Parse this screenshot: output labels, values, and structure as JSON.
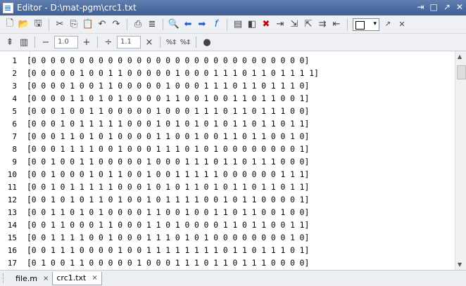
{
  "window": {
    "title": "Editor - D:\\mat-pgm\\crc1.txt",
    "controls": [
      "⇥",
      "□",
      "↗",
      "✕"
    ]
  },
  "toolbar2": {
    "decrement_value": "1.0",
    "increment_value": "1.1"
  },
  "editor": {
    "lines": [
      {
        "n": "1",
        "text": "[0 0 0 0 0 0 0 0 0 0 0 0 0 0 0 0 0 0 0 0 0 0 0 0 0 0 0 0 0]"
      },
      {
        "n": "2",
        "text": "[0 0 0 0 0 1 0 0 1 1 0 0 0 0 0 1 0 0 0 1 1 1 0 1 1 0 1 1 1 1]"
      },
      {
        "n": "3",
        "text": "[0 0 0 0 1 0 0 1 1 0 0 0 0 0 1 0 0 0 1 1 1 0 1 1 0 1 1 1 0]"
      },
      {
        "n": "4",
        "text": "[0 0 0 0 1 1 0 1 0 1 0 0 0 0 1 1 0 0 1 0 0 1 1 0 1 1 0 0 1]"
      },
      {
        "n": "5",
        "text": "[0 0 0 1 0 0 1 1 0 0 0 0 0 1 0 0 0 1 1 1 0 1 1 0 1 1 1 0 0]"
      },
      {
        "n": "6",
        "text": "[0 0 0 1 0 1 1 1 1 1 0 0 0 1 0 1 0 1 0 1 0 1 1 0 1 1 0 1 1]"
      },
      {
        "n": "7",
        "text": "[0 0 0 1 1 0 1 0 1 0 0 0 0 1 1 0 0 1 0 0 1 1 0 1 1 0 0 1 0]"
      },
      {
        "n": "8",
        "text": "[0 0 0 1 1 1 1 0 0 1 0 0 0 1 1 1 0 1 0 1 0 0 0 0 0 0 0 0 1]"
      },
      {
        "n": "9",
        "text": "[0 0 1 0 0 1 1 0 0 0 0 0 1 0 0 0 1 1 1 0 1 1 0 1 1 1 0 0 0]"
      },
      {
        "n": "10",
        "text": "[0 0 1 0 0 0 1 0 1 1 0 0 1 0 0 1 1 1 1 1 0 0 0 0 0 0 1 1 1]"
      },
      {
        "n": "11",
        "text": "[0 0 1 0 1 1 1 1 1 0 0 0 1 0 1 0 1 1 0 1 0 1 1 0 1 1 0 1 1]"
      },
      {
        "n": "12",
        "text": "[0 0 1 0 1 0 1 1 0 1 0 0 1 0 1 1 1 1 0 0 1 0 1 1 0 0 0 0 1]"
      },
      {
        "n": "13",
        "text": "[0 0 1 1 0 1 0 1 0 0 0 0 1 1 0 0 1 0 0 1 1 0 1 1 0 0 1 0 0]"
      },
      {
        "n": "14",
        "text": "[0 0 1 1 0 0 0 1 1 0 0 0 1 1 0 1 0 0 0 0 1 1 0 1 1 0 0 1 1]"
      },
      {
        "n": "15",
        "text": "[0 0 1 1 1 1 0 0 1 0 0 0 1 1 1 0 1 0 1 0 0 0 0 0 0 0 0 1 0]"
      },
      {
        "n": "16",
        "text": "[0 0 1 1 1 0 0 0 0 1 0 0 1 1 1 1 1 1 1 1 0 1 1 0 1 1 1 0 1]"
      },
      {
        "n": "17",
        "text": "[0 1 0 0 1 1 0 0 0 0 0 1 0 0 0 1 1 1 0 1 1 0 1 1 1 0 0 0 0]"
      }
    ]
  },
  "tabs": [
    {
      "label": "file.m",
      "close": "×"
    },
    {
      "label": "crc1.txt",
      "close": "×"
    }
  ],
  "icons": {
    "toolbar1": [
      "new-file",
      "open-folder",
      "save",
      "cut",
      "copy",
      "paste",
      "undo",
      "redo",
      "print",
      "compare",
      "find",
      "back",
      "forward",
      "function",
      "cell-mode",
      "breakpoint-set",
      "breakpoint-clear",
      "step",
      "step-in",
      "step-out",
      "continue",
      "exit-debug",
      "layout"
    ],
    "toolbar2": [
      "cell-run",
      "cell-eval",
      "minus",
      "plus",
      "divide",
      "multiply",
      "comment",
      "uncomment",
      "publish"
    ]
  }
}
